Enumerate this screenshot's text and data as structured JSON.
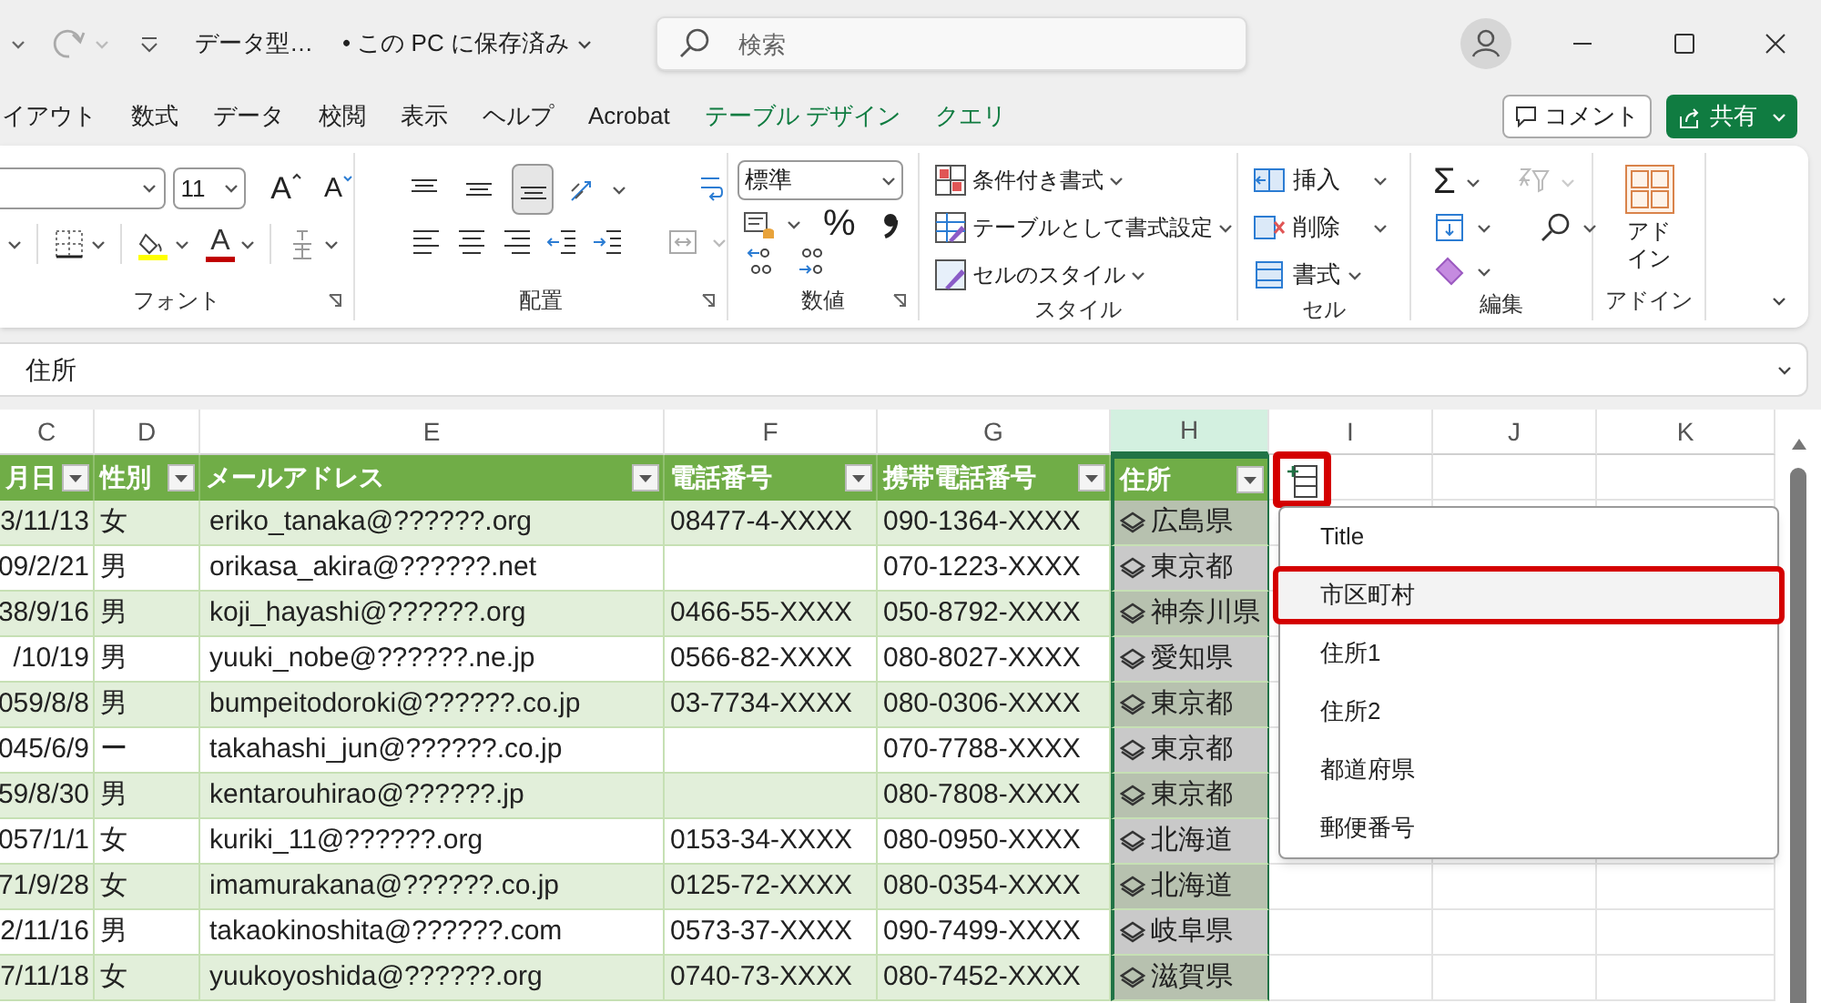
{
  "title_bar": {
    "document_title": "データ型…",
    "save_status": "• この PC に保存済み",
    "search": {
      "placeholder": "検索"
    }
  },
  "ribbon_tabs": [
    {
      "label": "イアウト",
      "contextual": false
    },
    {
      "label": "数式",
      "contextual": false
    },
    {
      "label": "データ",
      "contextual": false
    },
    {
      "label": "校閲",
      "contextual": false
    },
    {
      "label": "表示",
      "contextual": false
    },
    {
      "label": "ヘルプ",
      "contextual": false
    },
    {
      "label": "Acrobat",
      "contextual": false
    },
    {
      "label": "テーブル デザイン",
      "contextual": true
    },
    {
      "label": "クエリ",
      "contextual": true
    }
  ],
  "comment_button": "コメント",
  "share_button": "共有",
  "ribbon_groups": [
    {
      "kind": "font",
      "label": "フォント",
      "font_size": "11",
      "grow_font": "A",
      "shrink_font": "A",
      "font_color": "A"
    },
    {
      "kind": "alignment",
      "label": "配置",
      "vertical_align": [
        {
          "kind": "top",
          "selected": false
        },
        {
          "kind": "middle",
          "selected": false
        },
        {
          "kind": "bottom",
          "selected": true
        }
      ]
    },
    {
      "kind": "number",
      "label": "数値",
      "number_format": "標準",
      "percent": "%"
    },
    {
      "kind": "styles",
      "label": "スタイル",
      "buttons": [
        "条件付き書式",
        "テーブルとして書式設定",
        "セルのスタイル"
      ]
    },
    {
      "kind": "cells",
      "label": "セル",
      "buttons": [
        "挿入",
        "削除",
        "書式"
      ]
    },
    {
      "kind": "editing",
      "label": "編集",
      "sum": "Σ"
    },
    {
      "kind": "addins",
      "label": "アドイン",
      "button": "アドイン"
    }
  ],
  "formula_bar": {
    "value": "住所"
  },
  "column_headers": [
    {
      "label": "C",
      "selected": false
    },
    {
      "label": "D",
      "selected": false
    },
    {
      "label": "E",
      "selected": false
    },
    {
      "label": "F",
      "selected": false
    },
    {
      "label": "G",
      "selected": false
    },
    {
      "label": "H",
      "selected": true
    },
    {
      "label": "I",
      "selected": false
    },
    {
      "label": "J",
      "selected": false
    },
    {
      "label": "K",
      "selected": false
    }
  ],
  "table": {
    "columns": [
      "月日",
      "性別",
      "メールアドレス",
      "電話番号",
      "携帯電話番号",
      "住所"
    ],
    "rows": [
      [
        "3/11/13",
        "女",
        "eriko_tanaka@??????.org",
        "08477-4-XXXX",
        "090-1364-XXXX",
        "広島県"
      ],
      [
        "09/2/21",
        "男",
        "orikasa_akira@??????.net",
        null,
        "070-1223-XXXX",
        "東京都"
      ],
      [
        "38/9/16",
        "男",
        "koji_hayashi@??????.org",
        "0466-55-XXXX",
        "050-8792-XXXX",
        "神奈川県"
      ],
      [
        "/10/19",
        "男",
        "yuuki_nobe@??????.ne.jp",
        "0566-82-XXXX",
        "080-8027-XXXX",
        "愛知県"
      ],
      [
        "059/8/8",
        "男",
        "bumpeitodoroki@??????.co.jp",
        "03-7734-XXXX",
        "080-0306-XXXX",
        "東京都"
      ],
      [
        "045/6/9",
        "ー",
        "takahashi_jun@??????.co.jp",
        null,
        "070-7788-XXXX",
        "東京都"
      ],
      [
        "59/8/30",
        "男",
        "kentarouhirao@??????.jp",
        null,
        "080-7808-XXXX",
        "東京都"
      ],
      [
        "057/1/1",
        "女",
        "kuriki_11@??????.org",
        "0153-34-XXXX",
        "080-0950-XXXX",
        "北海道"
      ],
      [
        "71/9/28",
        "女",
        "imamurakana@??????.co.jp",
        "0125-72-XXXX",
        "080-0354-XXXX",
        "北海道"
      ],
      [
        "2/11/16",
        "男",
        "takaokinoshita@??????.com",
        "0573-37-XXXX",
        "090-7499-XXXX",
        "岐阜県"
      ],
      [
        "7/11/18",
        "女",
        "yuukoyoshida@??????.org",
        "0740-73-XXXX",
        "080-7452-XXXX",
        "滋賀県"
      ]
    ]
  },
  "field_menu": {
    "button_highlighted": true,
    "items": [
      {
        "label": "Title",
        "selected": false
      },
      {
        "label": "市区町村",
        "selected": true
      },
      {
        "label": "住所1",
        "selected": false
      },
      {
        "label": "住所2",
        "selected": false
      },
      {
        "label": "都道府県",
        "selected": false
      },
      {
        "label": "郵便番号",
        "selected": false
      }
    ]
  }
}
